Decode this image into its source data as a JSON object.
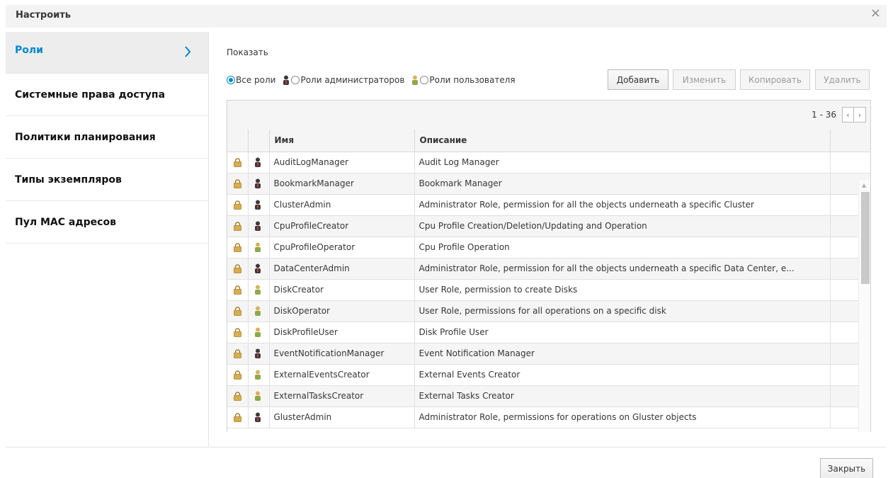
{
  "dialog": {
    "title": "Настроить",
    "close_glyph": "×"
  },
  "sidebar": {
    "items": [
      {
        "label": "Роли",
        "selected": true
      },
      {
        "label": "Системные права доступа"
      },
      {
        "label": "Политики планирования"
      },
      {
        "label": "Типы экземпляров"
      },
      {
        "label": "Пул MAC адресов"
      }
    ]
  },
  "main": {
    "show_label": "Показать",
    "filter": {
      "all": "Все роли",
      "admin": "Роли администраторов",
      "user": "Роли пользователя",
      "selected": "all"
    },
    "buttons": {
      "add": "Добавить",
      "edit": "Изменить",
      "copy": "Копировать",
      "delete": "Удалить"
    },
    "pager": {
      "range": "1 - 36",
      "prev": "‹",
      "next": "›"
    },
    "columns": [
      "Имя",
      "Описание"
    ],
    "rows": [
      {
        "role_type": "admin",
        "name": "AuditLogManager",
        "description": "Audit Log Manager"
      },
      {
        "role_type": "admin",
        "name": "BookmarkManager",
        "description": "Bookmark Manager"
      },
      {
        "role_type": "admin",
        "name": "ClusterAdmin",
        "description": "Administrator Role, permission for all the objects underneath a specific Cluster"
      },
      {
        "role_type": "admin",
        "name": "CpuProfileCreator",
        "description": "Cpu Profile Creation/Deletion/Updating and Operation"
      },
      {
        "role_type": "user",
        "name": "CpuProfileOperator",
        "description": "Cpu Profile Operation"
      },
      {
        "role_type": "admin",
        "name": "DataCenterAdmin",
        "description": "Administrator Role, permission for all the objects underneath a specific Data Center, e..."
      },
      {
        "role_type": "user",
        "name": "DiskCreator",
        "description": "User Role, permission to create Disks"
      },
      {
        "role_type": "user",
        "name": "DiskOperator",
        "description": "User Role, permissions for all operations on a specific disk"
      },
      {
        "role_type": "user",
        "name": "DiskProfileUser",
        "description": "Disk Profile User"
      },
      {
        "role_type": "admin",
        "name": "EventNotificationManager",
        "description": "Event Notification Manager"
      },
      {
        "role_type": "user",
        "name": "ExternalEventsCreator",
        "description": "External Events Creator"
      },
      {
        "role_type": "user",
        "name": "ExternalTasksCreator",
        "description": "External Tasks Creator"
      },
      {
        "role_type": "admin",
        "name": "GlusterAdmin",
        "description": "Administrator Role, permissions for operations on Gluster objects"
      }
    ]
  },
  "footer": {
    "close_label": "Закрыть"
  },
  "colors": {
    "accent": "#0088ce",
    "admin_icon": "#3a3a3a",
    "user_icon": "#8fa94a",
    "lock_icon": "#c8a24a"
  },
  "icons": {
    "lock": "lock-icon",
    "admin": "admin-user-icon",
    "user": "regular-user-icon"
  }
}
